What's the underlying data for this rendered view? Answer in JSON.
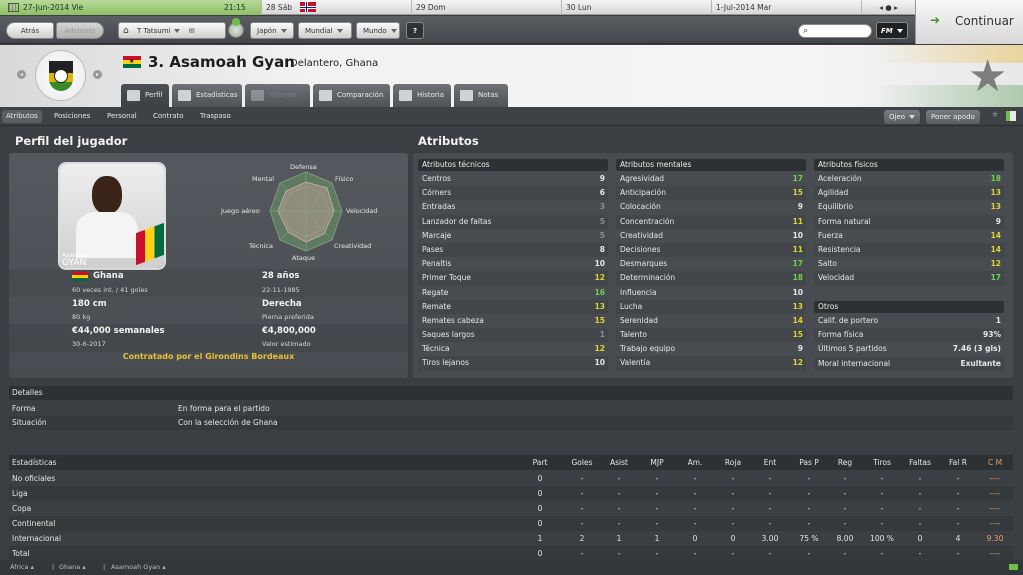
{
  "calendar": {
    "today": "27-Jun-2014 Vie",
    "time": "21:15",
    "days": [
      "28 Sáb",
      "29 Dom",
      "30 Lun",
      "1-Jul-2014 Mar"
    ]
  },
  "toolbar": {
    "back": "Atrás",
    "forward": "Adelante",
    "manager": "T Tatsumi",
    "nation": "Japón",
    "world_cup": "Mundial",
    "world": "Mundo",
    "help": "?",
    "fm": "FM",
    "continue": "Continuar"
  },
  "player": {
    "number_name": "3. Asamoah Gyan",
    "position": "Delantero, Ghana"
  },
  "tabs": [
    "Perfil",
    "Estadísticas",
    "Informe",
    "Comparación",
    "Historia",
    "Notas"
  ],
  "subnav": {
    "items": [
      "Atributos",
      "Posiciones",
      "Personal",
      "Contrato",
      "Traspaso"
    ],
    "scout": "Ojeo",
    "nickname": "Poner apodo"
  },
  "profile": {
    "title": "Perfil del jugador",
    "photo_label": "Asamoah",
    "photo_name": "GYAN",
    "radar": {
      "labels": [
        "Defensa",
        "Físico",
        "Velocidad",
        "Creatividad",
        "Ataque",
        "Técnica",
        "Juego aéreo",
        "Mental"
      ]
    },
    "nation": "Ghana",
    "caps": "60 veces int. / 41 goles",
    "age": "28 años",
    "dob": "22-11-1985",
    "height": "180 cm",
    "weight": "80 kg",
    "foot": "Derecha",
    "foot_label": "Pierna preferida",
    "wage": "€44,000 semanales",
    "contract_end": "30-6-2017",
    "value": "€4,800,000",
    "value_label": "Valor estimado",
    "contract": "Contratado por el Girondins Bordeaux"
  },
  "attributes": {
    "title": "Atributos",
    "technical": {
      "header": "Atributos técnicos",
      "rows": [
        [
          "Centros",
          "9"
        ],
        [
          "Córners",
          "6"
        ],
        [
          "Entradas",
          "3"
        ],
        [
          "Lanzador de faltas",
          "5"
        ],
        [
          "Marcaje",
          "5"
        ],
        [
          "Pases",
          "8"
        ],
        [
          "Penaltis",
          "10"
        ],
        [
          "Primer Toque",
          "12"
        ],
        [
          "Regate",
          "16"
        ],
        [
          "Remate",
          "13"
        ],
        [
          "Remates cabeza",
          "15"
        ],
        [
          "Saques largos",
          "1"
        ],
        [
          "Técnica",
          "12"
        ],
        [
          "Tiros lejanos",
          "10"
        ]
      ]
    },
    "mental": {
      "header": "Atributos mentales",
      "rows": [
        [
          "Agresividad",
          "17"
        ],
        [
          "Anticipación",
          "15"
        ],
        [
          "Colocación",
          "9"
        ],
        [
          "Concentración",
          "11"
        ],
        [
          "Creatividad",
          "10"
        ],
        [
          "Decisiones",
          "11"
        ],
        [
          "Desmarques",
          "17"
        ],
        [
          "Determinación",
          "18"
        ],
        [
          "Influencia",
          "10"
        ],
        [
          "Lucha",
          "13"
        ],
        [
          "Serenidad",
          "14"
        ],
        [
          "Talento",
          "15"
        ],
        [
          "Trabajo equipo",
          "9"
        ],
        [
          "Valentía",
          "12"
        ]
      ]
    },
    "physical": {
      "header": "Atributos físicos",
      "rows": [
        [
          "Aceleración",
          "18"
        ],
        [
          "Agilidad",
          "13"
        ],
        [
          "Equilibrio",
          "13"
        ],
        [
          "Forma natural",
          "9"
        ],
        [
          "Fuerza",
          "14"
        ],
        [
          "Resistencia",
          "14"
        ],
        [
          "Salto",
          "12"
        ],
        [
          "Velocidad",
          "17"
        ]
      ]
    },
    "other": {
      "header": "Otros",
      "rows": [
        [
          "Calif. de portero",
          "1"
        ],
        [
          "Forma física",
          "93%"
        ],
        [
          "Últimos 5 partidos",
          "7.46 (3 gls)"
        ],
        [
          "Moral internacional",
          "Exultante"
        ]
      ]
    }
  },
  "details": {
    "title": "Detalles",
    "rows": [
      [
        "Forma",
        "En forma para el partido"
      ],
      [
        "Situación",
        "Con la selección de Ghana"
      ]
    ]
  },
  "stats": {
    "title": "Estadísticas",
    "columns": [
      "Part",
      "Goles",
      "Asist",
      "MJP",
      "Am.",
      "Roja",
      "Ent",
      "Pas P",
      "Reg",
      "Tiros",
      "Faltas",
      "Fal R",
      "C M"
    ],
    "rows": [
      [
        "No oficiales",
        "0",
        "-",
        "-",
        "-",
        "-",
        "-",
        "-",
        "-",
        "-",
        "-",
        "-",
        "-",
        "----"
      ],
      [
        "Liga",
        "0",
        "-",
        "-",
        "-",
        "-",
        "-",
        "-",
        "-",
        "-",
        "-",
        "-",
        "-",
        "----"
      ],
      [
        "Copa",
        "0",
        "-",
        "-",
        "-",
        "-",
        "-",
        "-",
        "-",
        "-",
        "-",
        "-",
        "-",
        "----"
      ],
      [
        "Continental",
        "0",
        "-",
        "-",
        "-",
        "-",
        "-",
        "-",
        "-",
        "-",
        "-",
        "-",
        "-",
        "----"
      ],
      [
        "Internacional",
        "1",
        "2",
        "1",
        "1",
        "0",
        "0",
        "3.00",
        "75 %",
        "8.00",
        "100 %",
        "0",
        "4",
        "9.30"
      ],
      [
        "Total",
        "0",
        "-",
        "-",
        "-",
        "-",
        "-",
        "-",
        "-",
        "-",
        "-",
        "-",
        "-",
        "----"
      ]
    ]
  },
  "breadcrumb": [
    "África",
    "Ghana",
    "Asamoah Gyan"
  ]
}
